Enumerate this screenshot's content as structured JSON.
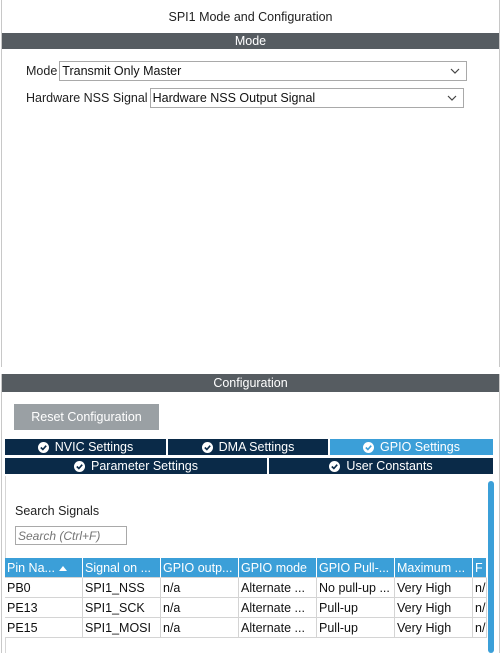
{
  "header": {
    "title": "SPI1 Mode and Configuration"
  },
  "mode_section": {
    "title": "Mode",
    "fields": [
      {
        "label": "Mode",
        "value": "Transmit Only Master"
      },
      {
        "label": "Hardware NSS Signal",
        "value": "Hardware NSS Output Signal"
      }
    ]
  },
  "config_section": {
    "title": "Configuration",
    "reset_label": "Reset Configuration",
    "tabs": [
      {
        "label": "NVIC Settings",
        "active": false
      },
      {
        "label": "DMA Settings",
        "active": false
      },
      {
        "label": "GPIO Settings",
        "active": true
      },
      {
        "label": "Parameter Settings",
        "active": false
      },
      {
        "label": "User Constants",
        "active": false
      }
    ],
    "search": {
      "title": "Search Signals",
      "placeholder": "Search (Ctrl+F)"
    },
    "table": {
      "columns": [
        "Pin Na...",
        "Signal on ...",
        "GPIO outp...",
        "GPIO mode",
        "GPIO Pull-...",
        "Maximum ...",
        "F"
      ],
      "rows": [
        [
          "PB0",
          "SPI1_NSS",
          "n/a",
          "Alternate ...",
          "No pull-up ...",
          "Very High",
          "n/"
        ],
        [
          "PE13",
          "SPI1_SCK",
          "n/a",
          "Alternate ...",
          "Pull-up",
          "Very High",
          "n/"
        ],
        [
          "PE15",
          "SPI1_MOSI",
          "n/a",
          "Alternate ...",
          "Pull-up",
          "Very High",
          "n/"
        ]
      ]
    }
  },
  "colors": {
    "section_bar": "#565c61",
    "tab_dark": "#0a2a48",
    "tab_active": "#3b9fd8",
    "button": "#9aa0a4"
  }
}
